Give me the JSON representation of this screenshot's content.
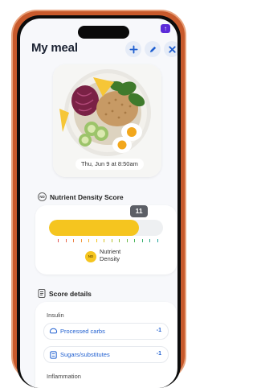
{
  "header": {
    "title": "My meal"
  },
  "status_badge": "↑",
  "meal_photo": {
    "timestamp": "Thu, Jun 9 at 8:50am"
  },
  "nutrient_density": {
    "section_title": "Nutrient Density Score",
    "icon_text": "ND",
    "score": "11",
    "fill_fraction": 0.79,
    "legend_label_line1": "Nutrient",
    "legend_label_line2": "Density",
    "legend_icon_text": "ND"
  },
  "score_details": {
    "section_title": "Score details",
    "insulin_label": "Insulin",
    "items": [
      {
        "label": "Processed carbs",
        "value": "-1",
        "icon": "bread-icon"
      },
      {
        "label": "Sugars/substitutes",
        "value": "-1",
        "icon": "sugar-icon"
      }
    ],
    "inflammation_label": "Inflammation"
  },
  "colors": {
    "accent": "#1f5fd0",
    "score_fill": "#f5c51f",
    "frame": "#c85a2c"
  }
}
